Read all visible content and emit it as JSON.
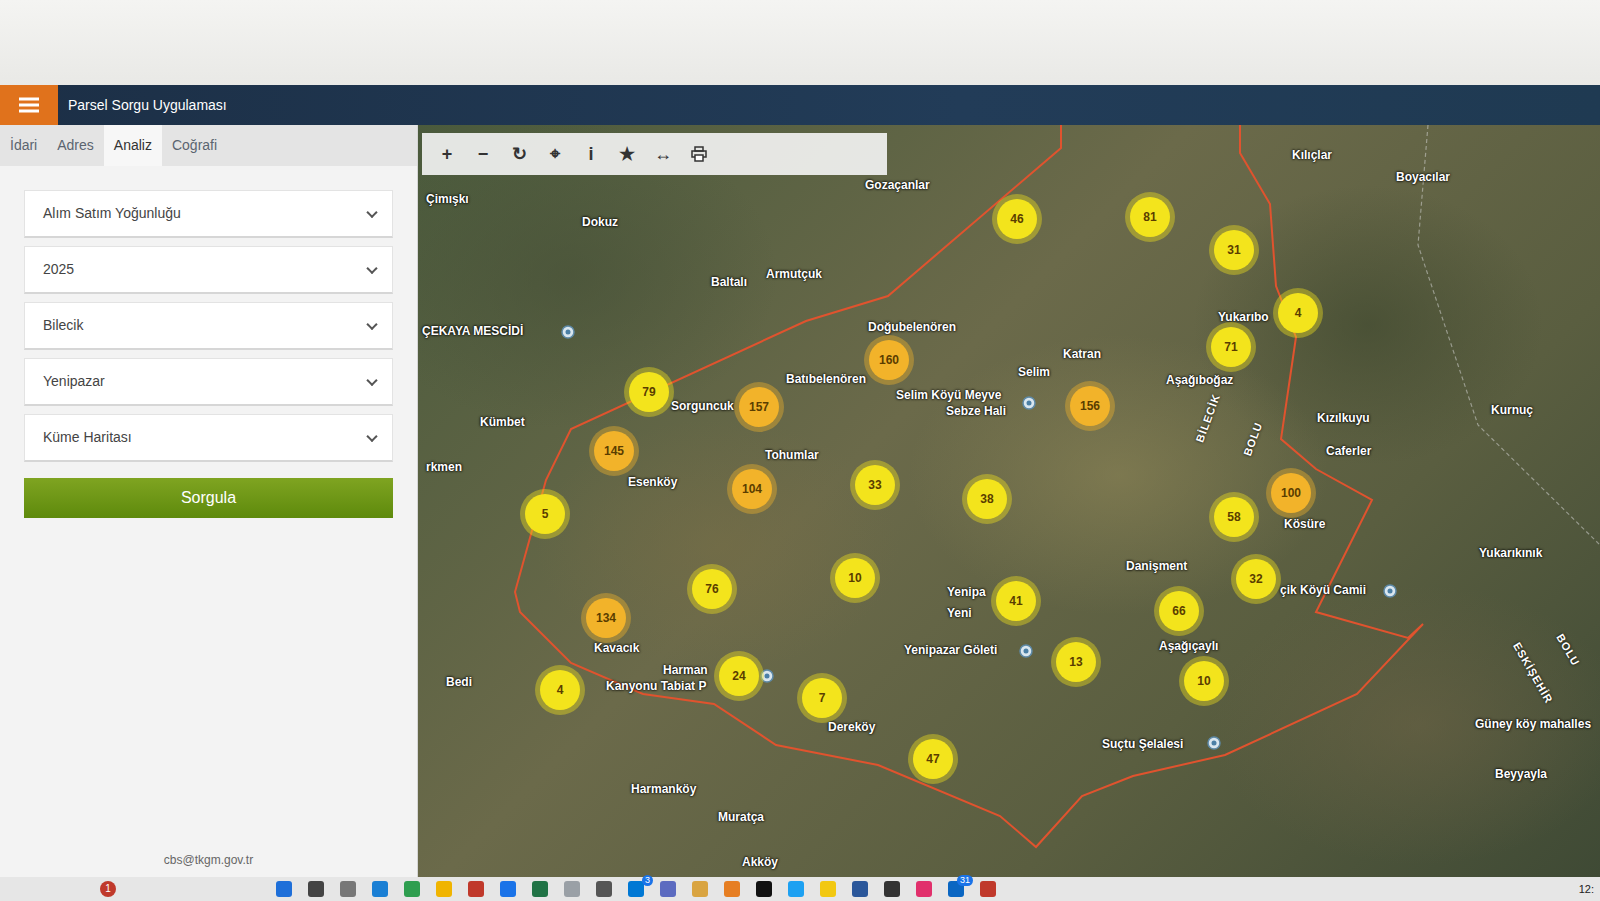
{
  "window": {
    "title": "Parsel Sorgu Uygulaması"
  },
  "tabs": [
    {
      "label": "İdari",
      "selected": false
    },
    {
      "label": "Adres",
      "selected": false
    },
    {
      "label": "Analiz",
      "selected": true
    },
    {
      "label": "Coğrafi",
      "selected": false
    }
  ],
  "filters": [
    {
      "value": "Alım Satım Yoğunluğu"
    },
    {
      "value": "2025"
    },
    {
      "value": "Bilecik"
    },
    {
      "value": "Yenipazar"
    },
    {
      "value": "Küme Haritası"
    }
  ],
  "query_button": "Sorgula",
  "footer": "cbs@tkgm.gov.tr",
  "toolbar": [
    {
      "kind": "glyph",
      "glyph": "+"
    },
    {
      "kind": "glyph",
      "glyph": "−"
    },
    {
      "kind": "glyph",
      "glyph": "↻"
    },
    {
      "kind": "glyph",
      "glyph": "⌖"
    },
    {
      "kind": "glyph",
      "glyph": "i"
    },
    {
      "kind": "glyph",
      "glyph": "★"
    },
    {
      "kind": "glyph",
      "glyph": "↔"
    },
    {
      "kind": "print"
    }
  ],
  "map": {
    "labels": [
      {
        "text": "Çimışkı",
        "kind": "place"
      },
      {
        "text": "Dokuz",
        "kind": "place"
      },
      {
        "text": "Gozaçanlar",
        "kind": "place"
      },
      {
        "text": "Kılıçlar",
        "kind": "place"
      },
      {
        "text": "Boyacılar",
        "kind": "place"
      },
      {
        "text": "Baltalı",
        "kind": "place"
      },
      {
        "text": "Armutçuk",
        "kind": "place"
      },
      {
        "text": "ÇEKAYA MESCİDİ",
        "kind": "place"
      },
      {
        "text": "Doğubelenören",
        "kind": "place"
      },
      {
        "text": "Katran",
        "kind": "place"
      },
      {
        "text": "Selim",
        "kind": "place"
      },
      {
        "text": "Batıbelenören",
        "kind": "place"
      },
      {
        "text": "Selim Köyü Meyve",
        "kind": "place"
      },
      {
        "text": "Sebze Hali",
        "kind": "place"
      },
      {
        "text": "Yukarıbo",
        "kind": "place"
      },
      {
        "text": "Aşağıboğaz",
        "kind": "place"
      },
      {
        "text": "Kızılkuyu",
        "kind": "place"
      },
      {
        "text": "Kurnuç",
        "kind": "place"
      },
      {
        "text": "Caferler",
        "kind": "place"
      },
      {
        "text": "Kümbet",
        "kind": "place"
      },
      {
        "text": "Sorguncuk",
        "kind": "place"
      },
      {
        "text": "Tohumlar",
        "kind": "place"
      },
      {
        "text": "Esenköy",
        "kind": "place"
      },
      {
        "text": "rkmen",
        "kind": "place"
      },
      {
        "text": "Kösüre",
        "kind": "place"
      },
      {
        "text": "Yukarıkınık",
        "kind": "place"
      },
      {
        "text": "Danişment",
        "kind": "place"
      },
      {
        "text": "Yenipa",
        "kind": "place"
      },
      {
        "text": "Yeni",
        "kind": "place"
      },
      {
        "text": "çik Köyü Camii",
        "kind": "place"
      },
      {
        "text": "Aşağıçaylı",
        "kind": "place"
      },
      {
        "text": "Yenipazar Göleti",
        "kind": "place"
      },
      {
        "text": "Kavacık",
        "kind": "place"
      },
      {
        "text": "Harman",
        "kind": "place"
      },
      {
        "text": "Kanyonu Tabiat P",
        "kind": "place"
      },
      {
        "text": "Bedi",
        "kind": "place"
      },
      {
        "text": "Dereköy",
        "kind": "place"
      },
      {
        "text": "Güney köy mahalles",
        "kind": "place"
      },
      {
        "text": "Beyyayla",
        "kind": "place"
      },
      {
        "text": "Suçtu Şelalesi",
        "kind": "place"
      },
      {
        "text": "Harmanköy",
        "kind": "place"
      },
      {
        "text": "Muratça",
        "kind": "place"
      },
      {
        "text": "Akköy",
        "kind": "place"
      },
      {
        "text": "BİLECİK",
        "kind": "province"
      },
      {
        "text": "BOLU",
        "kind": "province"
      },
      {
        "text": "ESKİŞEHİR",
        "kind": "province"
      },
      {
        "text": "BOLU",
        "kind": "province"
      }
    ],
    "clusters": [
      {
        "count": "46",
        "color": "#f3e41c"
      },
      {
        "count": "81",
        "color": "#f3e41c"
      },
      {
        "count": "31",
        "color": "#f3e41c"
      },
      {
        "count": "4",
        "color": "#f3e41c"
      },
      {
        "count": "71",
        "color": "#f3e41c"
      },
      {
        "count": "160",
        "color": "#f2b32a"
      },
      {
        "count": "156",
        "color": "#f2b32a"
      },
      {
        "count": "79",
        "color": "#f3e41c"
      },
      {
        "count": "157",
        "color": "#f2b32a"
      },
      {
        "count": "145",
        "color": "#f2b32a"
      },
      {
        "count": "104",
        "color": "#f2b32a"
      },
      {
        "count": "33",
        "color": "#f3e41c"
      },
      {
        "count": "38",
        "color": "#f3e41c"
      },
      {
        "count": "100",
        "color": "#f2b32a"
      },
      {
        "count": "58",
        "color": "#f3e41c"
      },
      {
        "count": "5",
        "color": "#f3e41c"
      },
      {
        "count": "10",
        "color": "#f3e41c"
      },
      {
        "count": "32",
        "color": "#f3e41c"
      },
      {
        "count": "76",
        "color": "#f3e41c"
      },
      {
        "count": "41",
        "color": "#f3e41c"
      },
      {
        "count": "66",
        "color": "#f3e41c"
      },
      {
        "count": "134",
        "color": "#f2b32a"
      },
      {
        "count": "13",
        "color": "#f3e41c"
      },
      {
        "count": "24",
        "color": "#f3e41c"
      },
      {
        "count": "10",
        "color": "#f3e41c"
      },
      {
        "count": "4",
        "color": "#f3e41c"
      },
      {
        "count": "7",
        "color": "#f3e41c"
      },
      {
        "count": "47",
        "color": "#f3e41c"
      }
    ]
  },
  "taskbar": {
    "notification": "1",
    "icons": [
      {
        "color": "#1e6fd9"
      },
      {
        "color": "#444444"
      },
      {
        "color": "#777777"
      },
      {
        "color": "#1a7fd4"
      },
      {
        "color": "#2e9e4f"
      },
      {
        "color": "#f0b400"
      },
      {
        "color": "#c0392b"
      },
      {
        "color": "#1a73e8"
      },
      {
        "color": "#217346"
      },
      {
        "color": "#9aa0a6"
      },
      {
        "color": "#555555"
      },
      {
        "color": "#0078d4",
        "badge": "3"
      },
      {
        "color": "#5c6bc0"
      },
      {
        "color": "#d9a441"
      },
      {
        "color": "#e67e22"
      },
      {
        "color": "#111111"
      },
      {
        "color": "#1da1f2"
      },
      {
        "color": "#f2c811"
      },
      {
        "color": "#2b579a"
      },
      {
        "color": "#333333"
      },
      {
        "color": "#e1306c"
      },
      {
        "color": "#0a66c2",
        "badge": "31"
      },
      {
        "color": "#c0392b"
      }
    ],
    "clock": "12:"
  }
}
